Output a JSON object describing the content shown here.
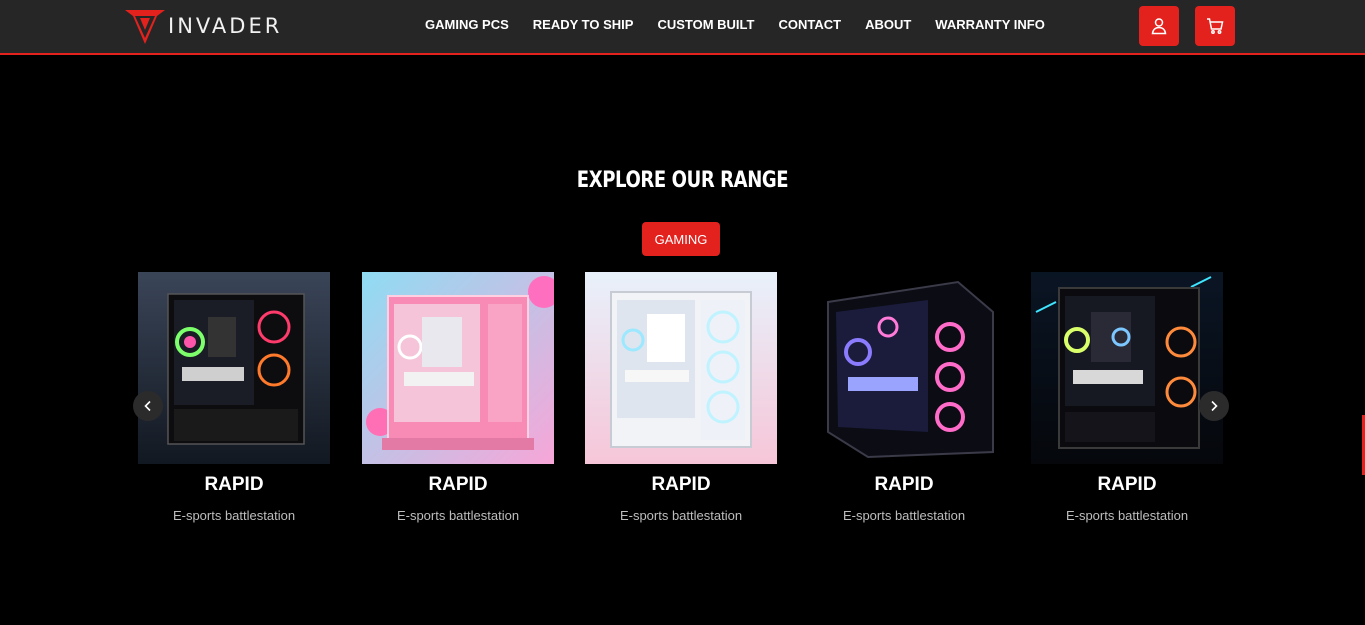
{
  "brand": {
    "name": "INVADER"
  },
  "nav": [
    {
      "label": "GAMING PCS"
    },
    {
      "label": "READY TO SHIP"
    },
    {
      "label": "CUSTOM BUILT"
    },
    {
      "label": "CONTACT"
    },
    {
      "label": "ABOUT"
    },
    {
      "label": "WARRANTY INFO"
    }
  ],
  "header_icons": {
    "account": "user-icon",
    "cart": "cart-icon"
  },
  "colors": {
    "accent": "#e3221e",
    "header_bg": "#262626",
    "page_bg": "#000000"
  },
  "section": {
    "title": "EXPLORE OUR RANGE",
    "filter_label": "GAMING"
  },
  "products": [
    {
      "title": "RAPID",
      "subtitle": "E-sports battlestation"
    },
    {
      "title": "RAPID",
      "subtitle": "E-sports battlestation"
    },
    {
      "title": "RAPID",
      "subtitle": "E-sports battlestation"
    },
    {
      "title": "RAPID",
      "subtitle": "E-sports battlestation"
    },
    {
      "title": "RAPID",
      "subtitle": "E-sports battlestation"
    }
  ],
  "carousel": {
    "prev_icon": "chevron-left-icon",
    "next_icon": "chevron-right-icon"
  }
}
